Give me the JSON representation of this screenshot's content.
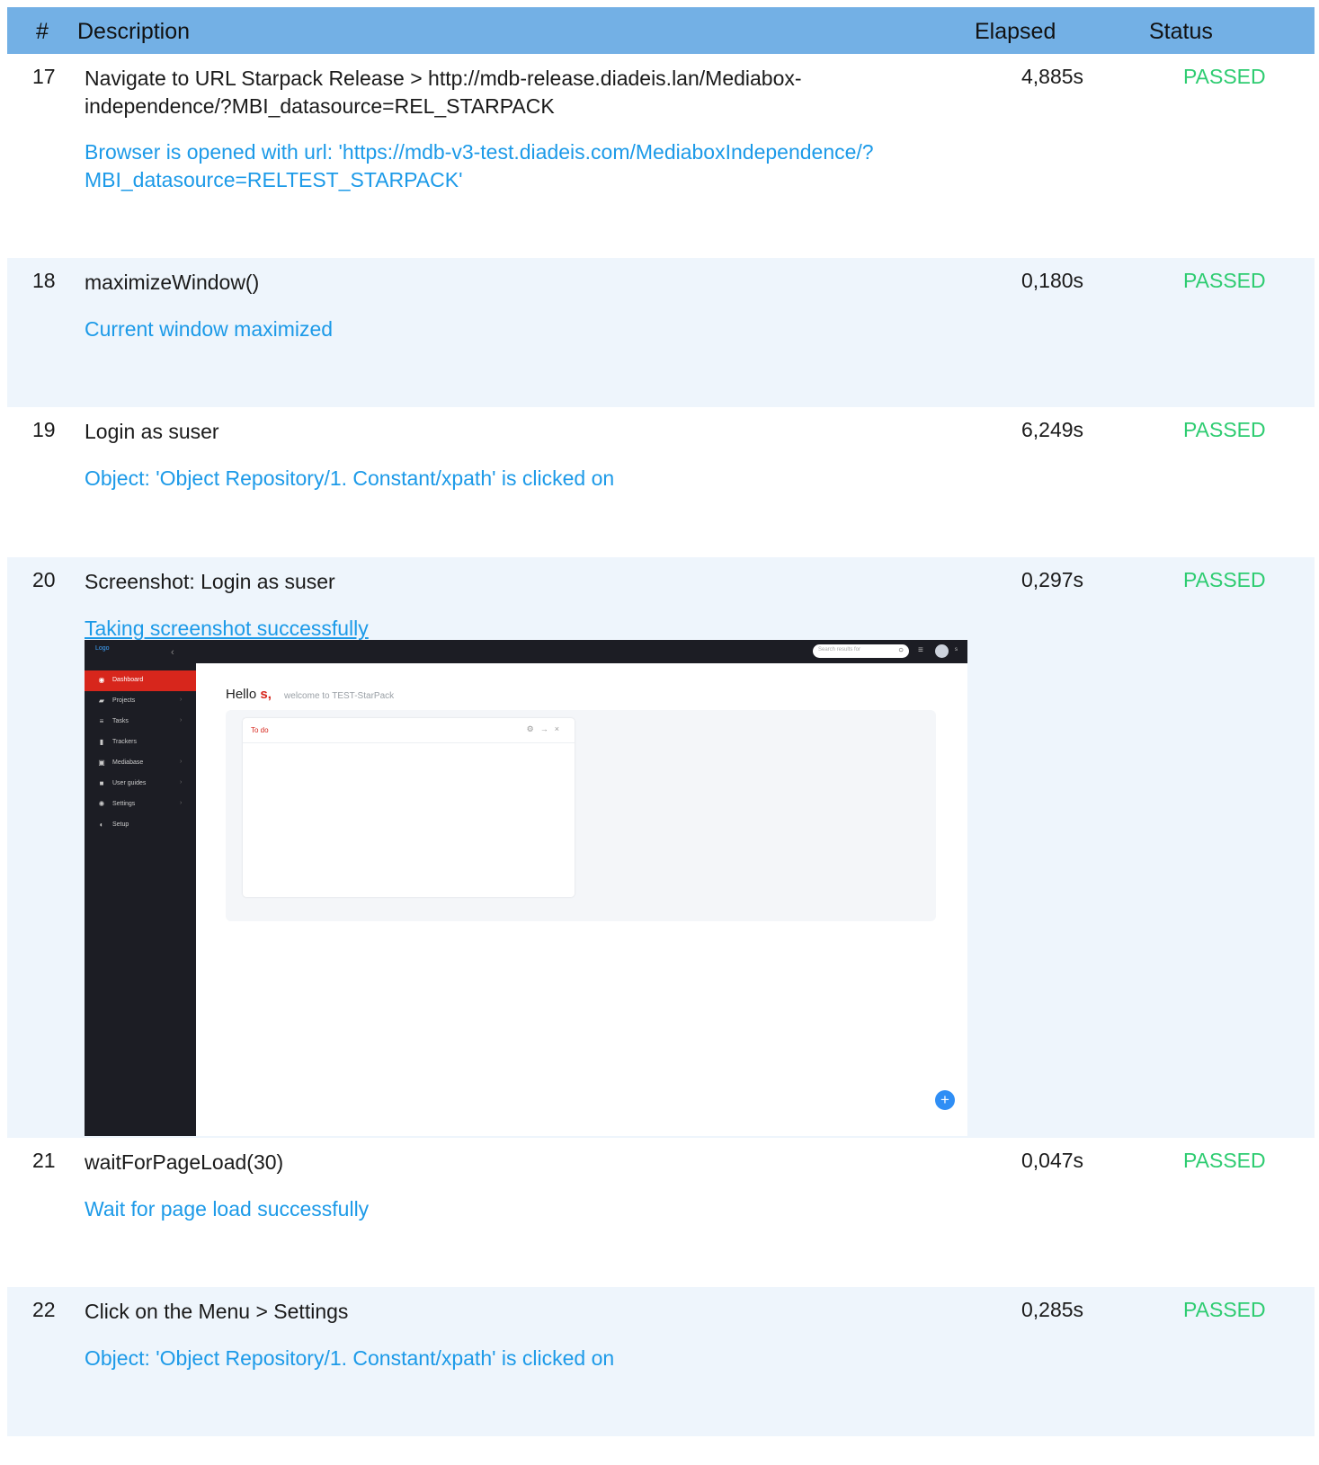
{
  "table": {
    "headers": {
      "num": "#",
      "description": "Description",
      "elapsed": "Elapsed",
      "status": "Status"
    },
    "status_color": "#2ecc71",
    "log_color": "#1c9ae8",
    "header_bg": "#73b0e5",
    "rows": [
      {
        "num": "17",
        "description": "Navigate to URL Starpack Release >  http://mdb-release.diadeis.lan/Mediabox-independence/?MBI_datasource=REL_STARPACK",
        "elapsed": "4,885s",
        "status": "PASSED",
        "log": "Browser is opened with url: 'https://mdb-v3-test.diadeis.com/MediaboxIndependence/?MBI_datasource=RELTEST_STARPACK'"
      },
      {
        "num": "18",
        "description": "maximizeWindow()",
        "elapsed": "0,180s",
        "status": "PASSED",
        "log": "Current window maximized"
      },
      {
        "num": "19",
        "description": "Login as suser",
        "elapsed": "6,249s",
        "status": "PASSED",
        "log": "Object: 'Object Repository/1. Constant/xpath' is clicked on"
      },
      {
        "num": "20",
        "description": "Screenshot: Login as suser",
        "elapsed": "0,297s",
        "status": "PASSED",
        "log": "Taking screenshot successfully"
      },
      {
        "num": "21",
        "description": "waitForPageLoad(30)",
        "elapsed": "0,047s",
        "status": "PASSED",
        "log": "Wait for page load successfully"
      },
      {
        "num": "22",
        "description": "Click on the Menu > Settings",
        "elapsed": "0,285s",
        "status": "PASSED",
        "log": "Object: 'Object Repository/1. Constant/xpath' is clicked on"
      }
    ]
  },
  "screenshot": {
    "logo": "Logo",
    "collapse_icon": "chevron-left-icon",
    "search_placeholder": "Search results for",
    "user": "s",
    "nav": [
      {
        "label": "Dashboard",
        "icon": "dashboard-icon",
        "active": true
      },
      {
        "label": "Projects",
        "icon": "folder-open-icon",
        "chevron": true
      },
      {
        "label": "Tasks",
        "icon": "list-icon",
        "chevron": true
      },
      {
        "label": "Trackers",
        "icon": "clipboard-icon"
      },
      {
        "label": "Mediabase",
        "icon": "image-icon",
        "chevron": true
      },
      {
        "label": "User guides",
        "icon": "folder-icon",
        "chevron": true
      },
      {
        "label": "Settings",
        "icon": "gear-icon",
        "chevron": true
      },
      {
        "label": "Setup",
        "icon": "toggle-icon"
      }
    ],
    "greeting": "Hello",
    "greeting_name": "s,",
    "welcome": "welcome to TEST-StarPack",
    "widget_title": "To do",
    "accent_color": "#d7261c",
    "fab_label": "+"
  }
}
